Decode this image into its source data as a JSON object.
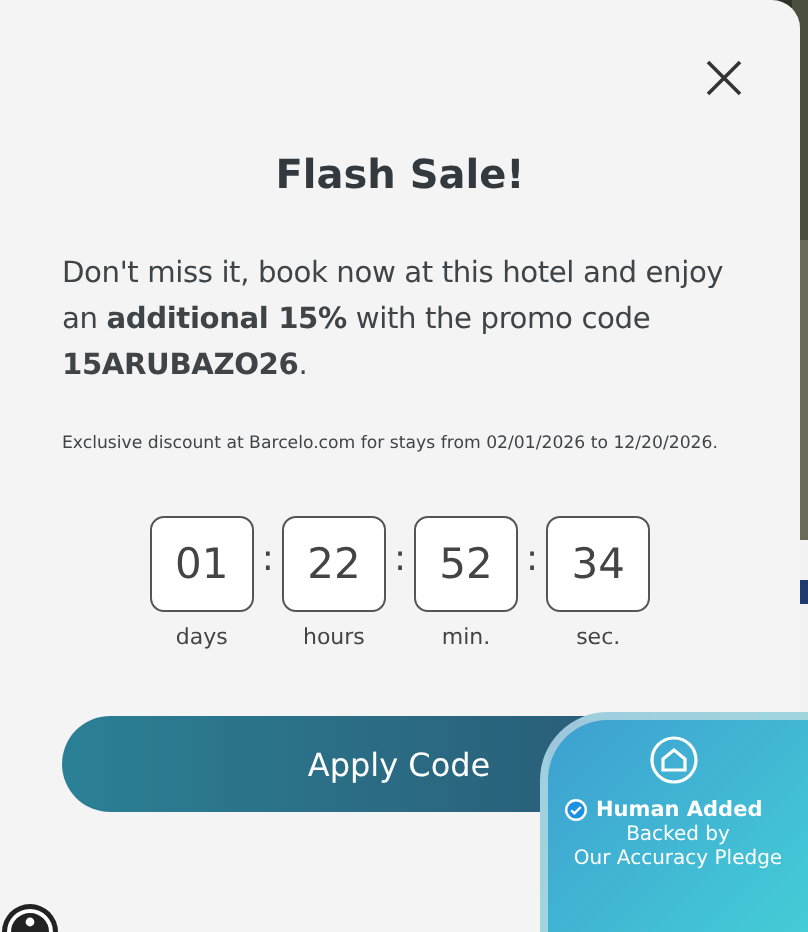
{
  "dialog": {
    "title": "Flash Sale!",
    "message": "Don't miss it, book now at this hotel and enjoy an **additional 15%** with the promo code **15ARUBAZO26**.",
    "fine_print": "Exclusive discount at Barcelo.com for stays from 02/01/2026 to 12/20/2026.",
    "countdown": [
      {
        "value": "01",
        "label": "days"
      },
      {
        "value": "22",
        "label": "hours"
      },
      {
        "value": "52",
        "label": "min."
      },
      {
        "value": "34",
        "label": "sec."
      }
    ],
    "separator": ":",
    "button": "Apply Code"
  },
  "badge": {
    "title": "Human Added",
    "lines": [
      "Backed by",
      "Our Accuracy Pledge"
    ]
  }
}
